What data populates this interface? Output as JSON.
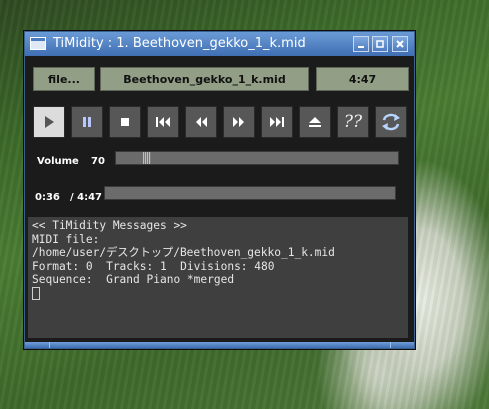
{
  "window": {
    "title": "TiMidity : 1. Beethoven_gekko_1_k.mid",
    "controls": [
      "minimize-icon",
      "maximize-icon",
      "close-icon"
    ]
  },
  "info": {
    "file_button": "file...",
    "filename": "Beethoven_gekko_1_k.mid",
    "duration": "4:47"
  },
  "transport": [
    {
      "name": "play-icon",
      "active": true
    },
    {
      "name": "pause-icon",
      "active": false
    },
    {
      "name": "stop-icon",
      "active": false
    },
    {
      "name": "skip-previous-icon",
      "active": false
    },
    {
      "name": "rewind-icon",
      "active": false
    },
    {
      "name": "fast-forward-icon",
      "active": false
    },
    {
      "name": "skip-next-icon",
      "active": false
    },
    {
      "name": "eject-icon",
      "active": false
    },
    {
      "name": "help-icon",
      "active": false,
      "text": "??"
    },
    {
      "name": "repeat-icon",
      "active": false
    }
  ],
  "volume": {
    "label": "Volume",
    "value": "70",
    "level": 0.1
  },
  "position": {
    "elapsed": "0:36",
    "total": "/ 4:47",
    "fraction": 0.0
  },
  "messages": {
    "lines": [
      "<< TiMidity Messages >>",
      "MIDI file:",
      "/home/user/デスクトップ/Beethoven_gekko_1_k.mid",
      "Format: 0  Tracks: 1  Divisions: 480",
      "Sequence:  Grand Piano *merged"
    ]
  },
  "colors": {
    "title_bar": "#4f7fc2",
    "info_box": "#939e86",
    "button": "#575757",
    "button_active": "#dcdcdc",
    "window_bg": "#1b1b1b",
    "messages_bg": "#3f3f3f"
  }
}
